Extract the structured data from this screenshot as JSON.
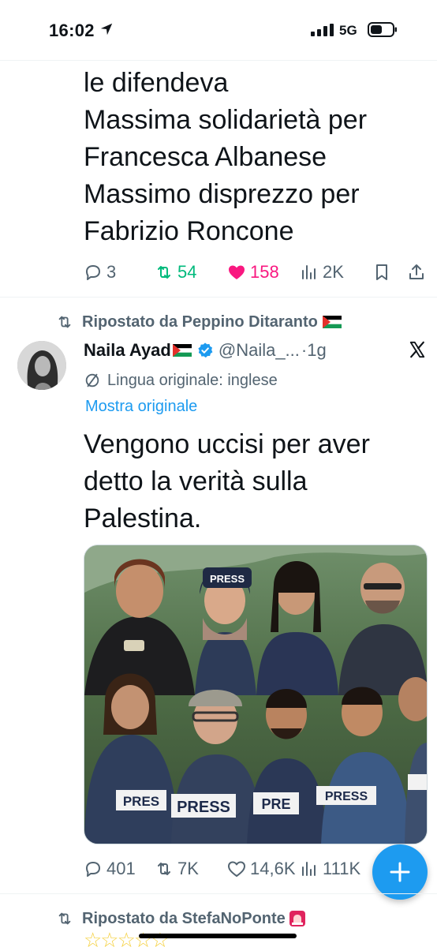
{
  "status": {
    "time": "16:02",
    "network": "5G"
  },
  "tweet1": {
    "text": "le difendeva\nMassima solidarietà per\nFrancesca Albanese\nMassimo disprezzo per\nFabrizio Roncone",
    "replies": "3",
    "reposts": "54",
    "likes": "158",
    "views": "2K"
  },
  "tweet2": {
    "repost_label": "Ripostato da Peppino Ditaranto",
    "author_name": "Naila Ayad",
    "handle": "@Naila_...",
    "time": "·1g",
    "lang_label": "Lingua originale: inglese",
    "show_original": "Mostra originale",
    "text": "Vengono uccisi per aver\ndetto la verità sulla\nPalestina.",
    "replies": "401",
    "reposts": "7K",
    "likes": "14,6K",
    "views": "111K",
    "press_labels": [
      "PRESS",
      "PRESS",
      "PRES",
      "PRE",
      "PRESS",
      "PRESS"
    ]
  },
  "tweet3": {
    "repost_label": "Ripostato da StefaNoPonte"
  },
  "colors": {
    "accent": "#1d9bf0",
    "repost_green": "#00ba7c",
    "like_pink": "#f91880",
    "muted": "#536471"
  },
  "icons": [
    "location-arrow-icon",
    "signal-icon",
    "battery-icon",
    "reply-icon",
    "repost-icon",
    "heart-icon",
    "views-icon",
    "bookmark-icon",
    "share-icon",
    "verified-icon",
    "x-logo-icon",
    "translate-icon",
    "compose-plus-icon"
  ]
}
